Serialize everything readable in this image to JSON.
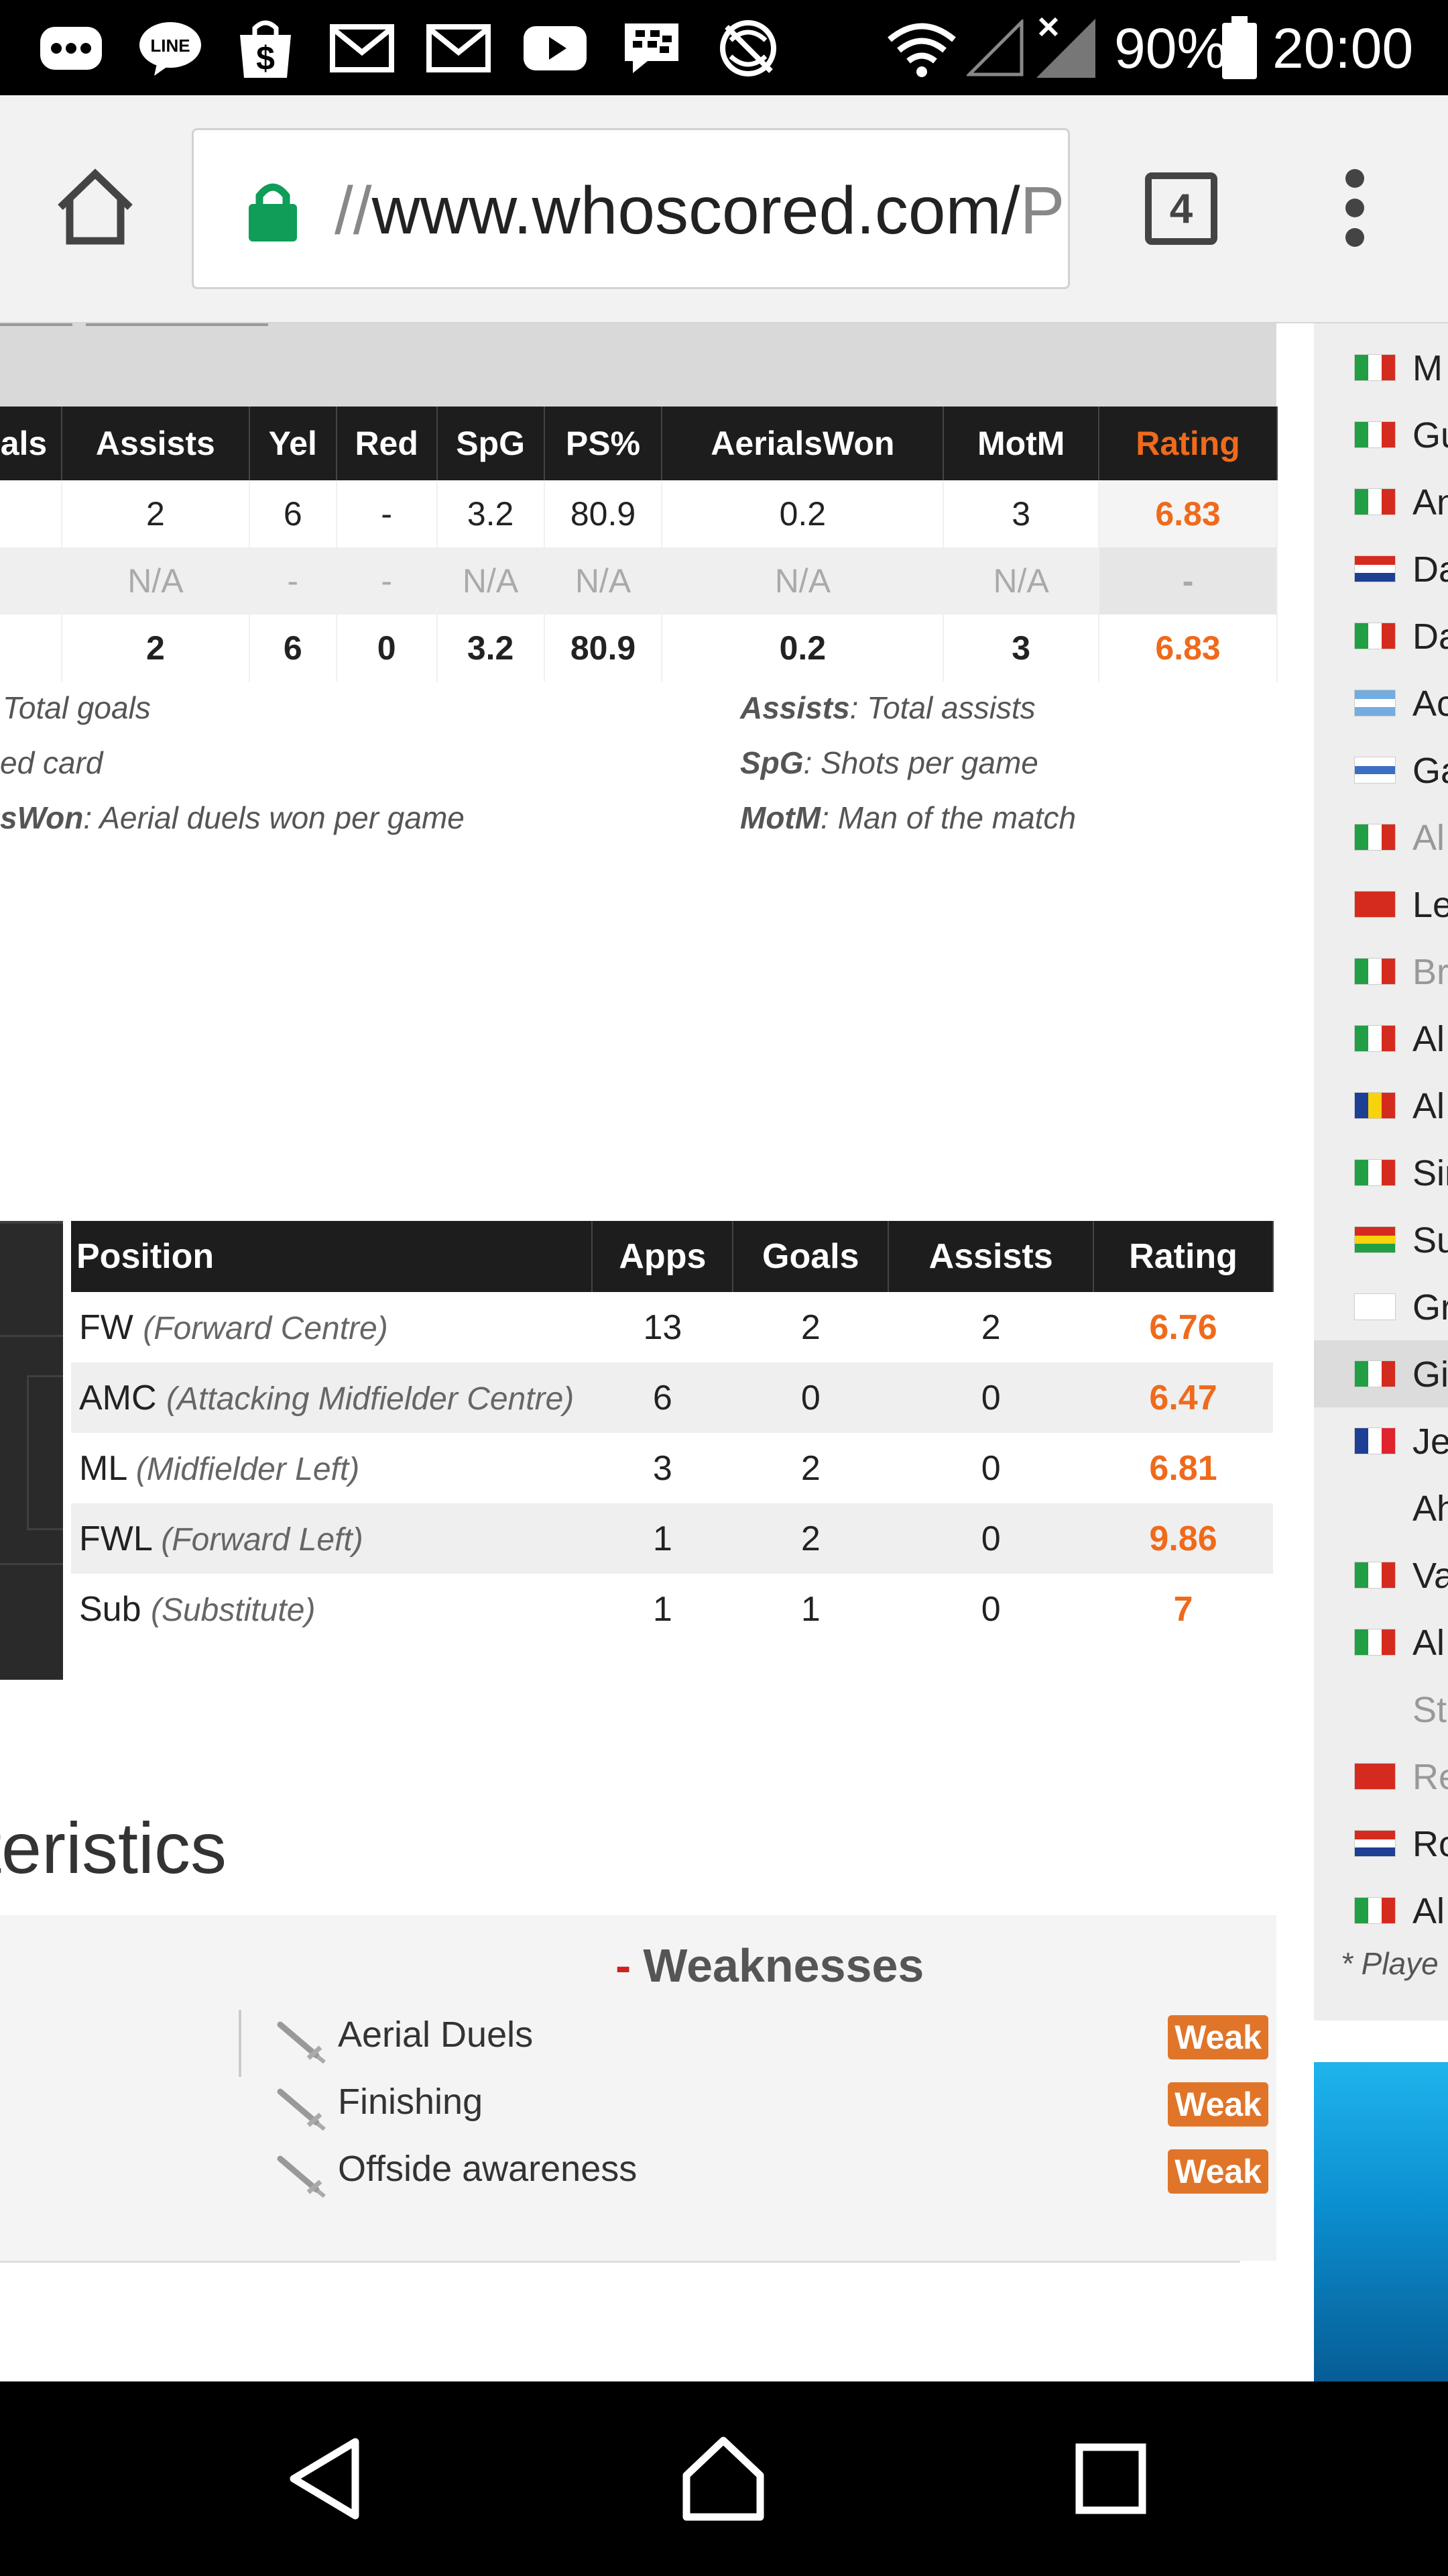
{
  "status_bar": {
    "icons": [
      "more-icon",
      "line-app-icon",
      "shopping-bag-icon",
      "gmail-icon",
      "gmail-icon",
      "youtube-icon",
      "blackberry-messenger-icon",
      "no-sync-icon",
      "wifi-icon",
      "signal-empty-icon",
      "signal-no-data-icon",
      "battery-icon"
    ],
    "battery_percent": "90%",
    "time": "20:00"
  },
  "browser": {
    "url_prefix": "//",
    "url_main": "www.whoscored.com/",
    "url_tail": "P",
    "tab_count": "4"
  },
  "stats_table": {
    "headers": [
      "als",
      "Assists",
      "Yel",
      "Red",
      "SpG",
      "PS%",
      "AerialsWon",
      "MotM",
      "Rating"
    ],
    "rows": [
      [
        "",
        "2",
        "6",
        "-",
        "3.2",
        "80.9",
        "0.2",
        "3",
        "6.83"
      ],
      [
        "",
        "N/A",
        "-",
        "-",
        "N/A",
        "N/A",
        "N/A",
        "N/A",
        "-"
      ],
      [
        "",
        "2",
        "6",
        "0",
        "3.2",
        "80.9",
        "0.2",
        "3",
        "6.83"
      ]
    ]
  },
  "legend": {
    "left": [
      {
        "key": "",
        "text": "Total goals"
      },
      {
        "key": "",
        "text": "ed card"
      },
      {
        "key": "sWon",
        "text": ": Aerial duels won per game"
      }
    ],
    "right": [
      {
        "key": "Assists",
        "text": ": Total assists"
      },
      {
        "key": "SpG",
        "text": ": Shots per game"
      },
      {
        "key": "MotM",
        "text": ": Man of the match"
      }
    ]
  },
  "positions_table": {
    "headers": [
      "Position",
      "Apps",
      "Goals",
      "Assists",
      "Rating"
    ],
    "rows": [
      {
        "code": "FW",
        "desc": "(Forward Centre)",
        "apps": "13",
        "goals": "2",
        "assists": "2",
        "rating": "6.76"
      },
      {
        "code": "AMC",
        "desc": "(Attacking Midfielder Centre)",
        "apps": "6",
        "goals": "0",
        "assists": "0",
        "rating": "6.47"
      },
      {
        "code": "ML",
        "desc": "(Midfielder Left)",
        "apps": "3",
        "goals": "2",
        "assists": "0",
        "rating": "6.81"
      },
      {
        "code": "FWL",
        "desc": "(Forward Left)",
        "apps": "1",
        "goals": "2",
        "assists": "0",
        "rating": "9.86"
      },
      {
        "code": "Sub",
        "desc": "(Substitute)",
        "apps": "1",
        "goals": "1",
        "assists": "0",
        "rating": "7"
      }
    ]
  },
  "characteristics": {
    "title": "teristics",
    "weaknesses_minus": "-",
    "weaknesses_title": "Weaknesses",
    "items": [
      {
        "label": "Aerial Duels",
        "level": "Weak"
      },
      {
        "label": "Finishing",
        "level": "Weak"
      },
      {
        "label": "Offside awareness",
        "level": "Weak"
      }
    ]
  },
  "sidebar": {
    "players": [
      {
        "name": "M",
        "flag": "italy",
        "muted": false
      },
      {
        "name": "Gu",
        "flag": "italy",
        "muted": false
      },
      {
        "name": "An",
        "flag": "italy",
        "muted": false
      },
      {
        "name": "Da",
        "flag": "croatia",
        "muted": false
      },
      {
        "name": "Da",
        "flag": "italy",
        "muted": false
      },
      {
        "name": "Ac",
        "flag": "argentina",
        "muted": false
      },
      {
        "name": "Ga",
        "flag": "uruguay",
        "muted": false
      },
      {
        "name": "Al",
        "flag": "italy",
        "muted": true
      },
      {
        "name": "Le",
        "flag": "albania",
        "muted": false
      },
      {
        "name": "Br",
        "flag": "italy",
        "muted": true
      },
      {
        "name": "Al",
        "flag": "italy",
        "muted": false
      },
      {
        "name": "Al",
        "flag": "romania",
        "muted": false
      },
      {
        "name": "Sir",
        "flag": "italy",
        "muted": false
      },
      {
        "name": "Su",
        "flag": "ghana",
        "muted": false
      },
      {
        "name": "Gr",
        "flag": "cyprus",
        "muted": false
      },
      {
        "name": "Gi",
        "flag": "italy",
        "muted": false
      },
      {
        "name": "Je",
        "flag": "france",
        "muted": false
      },
      {
        "name": "Ah",
        "flag": "",
        "muted": false
      },
      {
        "name": "Va",
        "flag": "italy",
        "muted": false
      },
      {
        "name": "Al",
        "flag": "italy",
        "muted": false
      },
      {
        "name": "St",
        "flag": "",
        "muted": true
      },
      {
        "name": "Re",
        "flag": "albania",
        "muted": true
      },
      {
        "name": "Ro",
        "flag": "croatia",
        "muted": false
      },
      {
        "name": "Al",
        "flag": "italy",
        "muted": false
      }
    ],
    "highlighted_index": 15,
    "footnote": "* Playe"
  },
  "nav_bar": {
    "buttons": [
      "back-icon",
      "home-icon",
      "recents-icon"
    ]
  },
  "colors": {
    "rating_orange": "#ef6a1b",
    "weak_badge": "#e0752a",
    "header_dark": "#1d1d1d",
    "lock_green": "#0f9d58"
  }
}
